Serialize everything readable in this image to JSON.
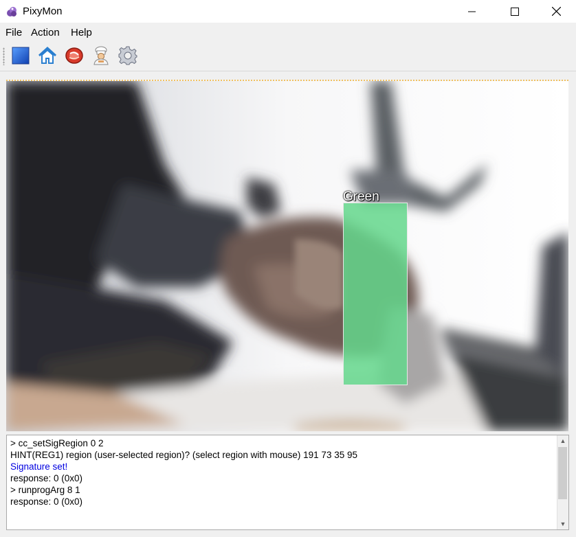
{
  "window": {
    "title": "PixyMon"
  },
  "menu": {
    "items": [
      "File",
      "Action",
      "Help"
    ]
  },
  "toolbar": {
    "buttons": [
      {
        "icon": "blue-square-icon"
      },
      {
        "icon": "home-icon"
      },
      {
        "icon": "meat-icon"
      },
      {
        "icon": "chef-icon"
      },
      {
        "icon": "gear-icon"
      }
    ]
  },
  "video": {
    "detection_label": "Green"
  },
  "console": {
    "lines": [
      {
        "text": "> cc_setSigRegion 0 2",
        "color": "#000000"
      },
      {
        "text": "HINT(REG1)  region (user-selected region)? (select region with mouse) 191 73 35 95",
        "color": "#000000"
      },
      {
        "text": "Signature set!",
        "color": "#0000e0"
      },
      {
        "text": "response: 0 (0x0)",
        "color": "#000000"
      },
      {
        "text": "> runprogArg 8 1",
        "color": "#000000"
      },
      {
        "text": "response: 0 (0x0)",
        "color": "#000000"
      }
    ]
  }
}
